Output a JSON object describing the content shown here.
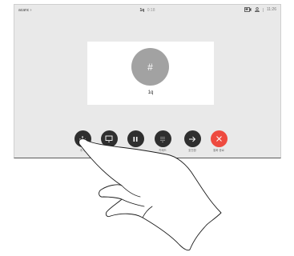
{
  "status_bar": {
    "left_label": "acanc",
    "call_name": "1q",
    "call_time": "0:18",
    "clock": "11:26"
  },
  "card": {
    "avatar_initial": "#",
    "name": "1q"
  },
  "controls": [
    {
      "id": "add",
      "label": "추가"
    },
    {
      "id": "share",
      "label": ""
    },
    {
      "id": "hold",
      "label": "대기"
    },
    {
      "id": "keypad",
      "label": "키패드"
    },
    {
      "id": "transfer",
      "label": "호전환"
    },
    {
      "id": "end",
      "label": "통화 종료"
    }
  ],
  "colors": {
    "screen_bg": "#e9e9e9",
    "button": "#2f2f2f",
    "end_button": "#ee4a3f",
    "avatar": "#a2a2a2"
  }
}
